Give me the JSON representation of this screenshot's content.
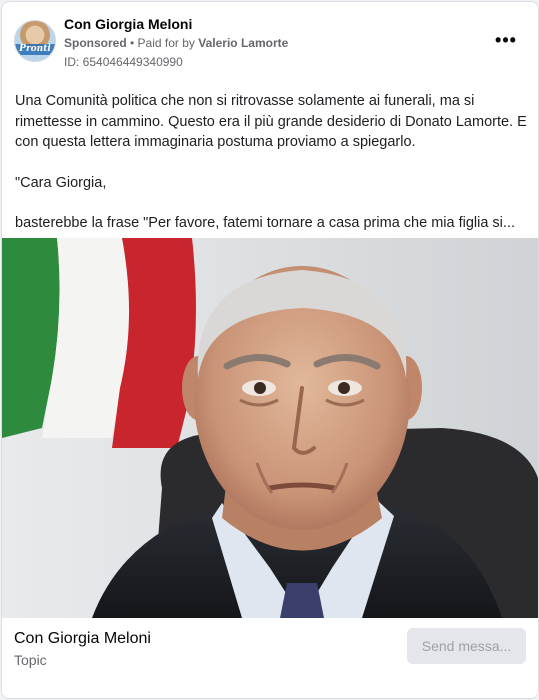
{
  "post": {
    "page_name": "Con Giorgia Meloni",
    "avatar_badge": "Pronti",
    "sponsored_label": "Sponsored",
    "separator": " • ",
    "paid_for_label": "Paid for by ",
    "paid_for_name": "Valerio Lamorte",
    "ad_id": "ID: 654046449340990",
    "more_icon": "more-horizontal-icon",
    "more_glyph": "•••",
    "text_paragraphs": [
      "Una Comunità politica che non si ritrovasse solamente ai funerali, ma si rimettesse in cammino. Questo era il più grande desiderio di Donato Lamorte. E con questa lettera immaginaria postuma proviamo a spiegarlo.",
      "\"Cara Giorgia,",
      "basterebbe la frase \"Per favore, fatemi tornare a casa prima che mia figlia si..."
    ]
  },
  "footer": {
    "title": "Con Giorgia Meloni",
    "subtitle": "Topic",
    "cta_label": "Send messa..."
  },
  "colors": {
    "flag_green": "#2e8b3e",
    "flag_white": "#f4f4f2",
    "flag_red": "#c9252c",
    "button_bg": "#e4e6eb",
    "meta_text": "#65676b"
  }
}
